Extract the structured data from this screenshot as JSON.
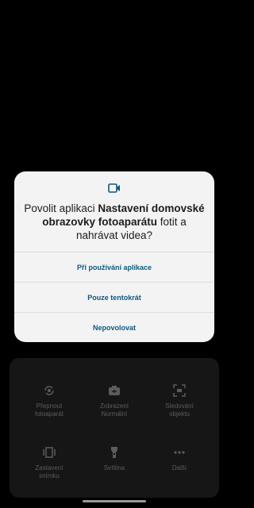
{
  "menu": {
    "items": [
      {
        "label": "Přepnout",
        "sub": "fotoaparát",
        "icon": "switch-camera-icon"
      },
      {
        "label": "Zobrazení",
        "sub": "Normální",
        "icon": "view-mode-icon"
      },
      {
        "label": "Sledování",
        "sub": "objektu",
        "icon": "object-tracking-icon"
      },
      {
        "label": "Zastavení",
        "sub": "snímku",
        "icon": "freeze-frame-icon"
      },
      {
        "label": "Svítilna",
        "sub": "",
        "icon": "flashlight-icon"
      },
      {
        "label": "Další",
        "sub": "",
        "icon": "more-icon"
      }
    ]
  },
  "dialog": {
    "icon": "video-camera-icon",
    "title_prefix": "Povolit aplikaci ",
    "title_app": "Nastavení domovské obrazovky fotoaparátu",
    "title_suffix": " fotit a nahrávat videa?",
    "buttons": {
      "while_using": "Při používání aplikace",
      "only_this_time": "Pouze tentokrát",
      "deny": "Nepovolovat"
    },
    "accent_color": "#0d5a80"
  }
}
